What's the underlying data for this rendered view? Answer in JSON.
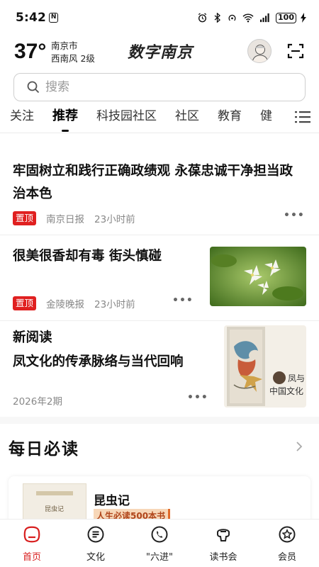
{
  "status_bar": {
    "time": "5:42",
    "battery": "100"
  },
  "header": {
    "temperature": "37°",
    "city": "南京市",
    "wind": "西南风  2级",
    "app_name": "数字南京"
  },
  "search": {
    "placeholder": "搜索"
  },
  "tabs": [
    {
      "label": "关注",
      "active": false
    },
    {
      "label": "推荐",
      "active": true
    },
    {
      "label": "科技园社区",
      "active": false
    },
    {
      "label": "社区",
      "active": false
    },
    {
      "label": "教育",
      "active": false
    },
    {
      "label": "健",
      "active": false
    }
  ],
  "feed": [
    {
      "title_line1": "牢固树立和践行正确政绩观  永葆忠诚干净担当政",
      "title_line2": "治本色",
      "pin_label": "置顶",
      "source": "南京日报",
      "time": "23小时前"
    },
    {
      "title": "很美很香却有毒  街头慎碰",
      "pin_label": "置顶",
      "source": "金陵晚报",
      "time": "23小时前"
    },
    {
      "column": "新阅读",
      "title": "凤文化的传承脉络与当代回响",
      "issue": "2026年2期",
      "cover_text_line1": "凤与",
      "cover_text_line2": "中国文化"
    }
  ],
  "daily": {
    "section_title": "每日必读",
    "book_title": "昆虫记",
    "book_tag": "人生必读500本书",
    "cover_text": "昆虫记"
  },
  "bottom_nav": [
    {
      "label": "首页",
      "icon": "home-icon",
      "active": true
    },
    {
      "label": "文化",
      "icon": "culture-icon",
      "active": false
    },
    {
      "label": "\"六进\"",
      "icon": "phone-icon",
      "active": false
    },
    {
      "label": "读书会",
      "icon": "reading-club-icon",
      "active": false
    },
    {
      "label": "会员",
      "icon": "member-icon",
      "active": false
    }
  ],
  "colors": {
    "accent": "#d81e1e",
    "pin": "#e02020"
  }
}
